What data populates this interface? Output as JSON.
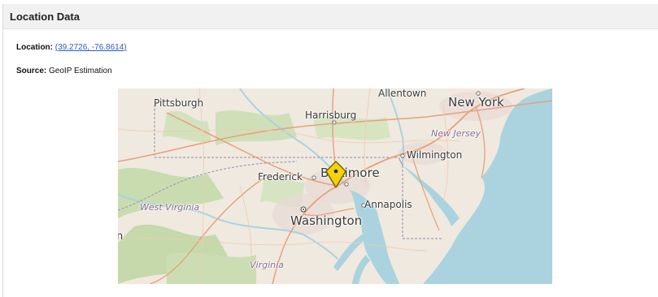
{
  "panel": {
    "title": "Location Data"
  },
  "location": {
    "label": "Location:",
    "value": "(39.2726, -76.8614)"
  },
  "source": {
    "label": "Source:",
    "value": "GeoIP Estimation"
  },
  "map": {
    "labels": {
      "pittsburgh": "Pittsburgh",
      "allentown": "Allentown",
      "new_york": "New York",
      "harrisburg": "Harrisburg",
      "new_jersey": "New Jersey",
      "wilmington": "Wilmington",
      "frederick": "Frederick",
      "baltimore": "Baltimore",
      "west_virginia": "West Virginia",
      "annapolis": "Annapolis",
      "washington": "Washington",
      "virginia": "Virginia",
      "left_edge": "n"
    },
    "marker_color": "#f5d20a"
  }
}
